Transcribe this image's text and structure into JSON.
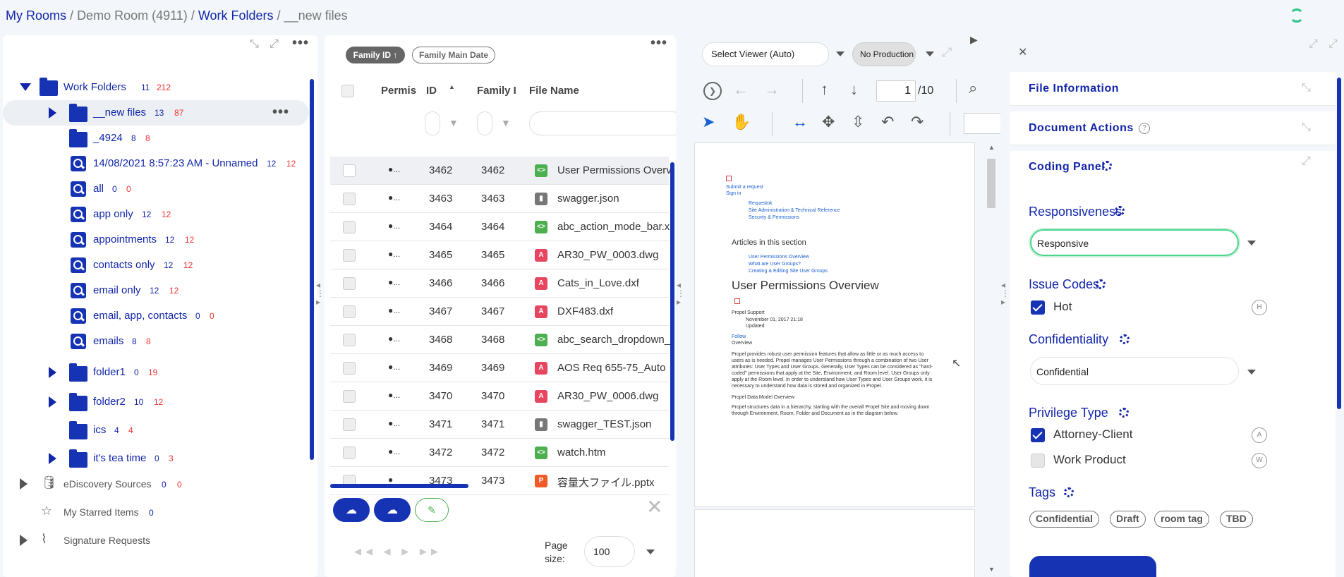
{
  "breadcrumb": {
    "root": "My Rooms",
    "sep": "/",
    "room": "Demo Room (4911)",
    "folders": "Work Folders",
    "current": "__new files"
  },
  "tree": {
    "root": {
      "label": "Work Folders",
      "c1": "11",
      "c2": "212"
    },
    "items": [
      {
        "label": "__new files",
        "c1": "13",
        "c2": "87",
        "icon": "folder-link-icon"
      },
      {
        "label": "_4924",
        "c1": "8",
        "c2": "8",
        "icon": "folder-link-icon"
      },
      {
        "label": "14/08/2021 8:57:23 AM - Unnamed",
        "c1": "12",
        "c2": "12",
        "icon": "saved-search-icon"
      },
      {
        "label": "all",
        "c1": "0",
        "c2": "0",
        "icon": "saved-search-icon"
      },
      {
        "label": "app only",
        "c1": "12",
        "c2": "12",
        "icon": "saved-search-icon"
      },
      {
        "label": "appointments",
        "c1": "12",
        "c2": "12",
        "icon": "saved-search-icon"
      },
      {
        "label": "contacts only",
        "c1": "12",
        "c2": "12",
        "icon": "saved-search-icon"
      },
      {
        "label": "email only",
        "c1": "12",
        "c2": "12",
        "icon": "saved-search-icon"
      },
      {
        "label": "email, app, contacts",
        "c1": "0",
        "c2": "0",
        "icon": "saved-search-icon"
      },
      {
        "label": "emails",
        "c1": "8",
        "c2": "8",
        "icon": "saved-search-icon"
      },
      {
        "label": "folder1",
        "c1": "0",
        "c2": "19",
        "icon": "folder-link-icon"
      },
      {
        "label": "folder2",
        "c1": "10",
        "c2": "12",
        "icon": "folder-link-icon"
      },
      {
        "label": "ics",
        "c1": "4",
        "c2": "4",
        "icon": "folder-link-icon"
      },
      {
        "label": "it's tea time",
        "c1": "0",
        "c2": "3",
        "icon": "folder-link-icon"
      }
    ],
    "bottom": [
      {
        "label": "eDiscovery Sources",
        "c1": "0",
        "c2": "0",
        "icon": "database-icon"
      },
      {
        "label": "My Starred Items",
        "c1": "0",
        "icon": "star-icon"
      },
      {
        "label": "Signature Requests",
        "icon": "signature-icon"
      }
    ]
  },
  "grid": {
    "sort_pills": [
      "Family ID ↑",
      "Family Main Date"
    ],
    "columns": {
      "perm": "Permis",
      "id": "ID",
      "family": "Family I",
      "filename": "File Name"
    },
    "rows": [
      {
        "perm": "●...",
        "id": "3462",
        "family": "3462",
        "type": "code",
        "name": "User Permissions Overv"
      },
      {
        "perm": "●...",
        "id": "3463",
        "family": "3463",
        "type": "doc",
        "name": "swagger.json"
      },
      {
        "perm": "●...",
        "id": "3464",
        "family": "3464",
        "type": "code",
        "name": "abc_action_mode_bar.x"
      },
      {
        "perm": "●...",
        "id": "3465",
        "family": "3465",
        "type": "cad",
        "name": "AR30_PW_0003.dwg"
      },
      {
        "perm": "●...",
        "id": "3466",
        "family": "3466",
        "type": "cad",
        "name": "Cats_in_Love.dxf"
      },
      {
        "perm": "●...",
        "id": "3467",
        "family": "3467",
        "type": "cad",
        "name": "DXF483.dxf"
      },
      {
        "perm": "●...",
        "id": "3468",
        "family": "3468",
        "type": "code",
        "name": "abc_search_dropdown_"
      },
      {
        "perm": "●...",
        "id": "3469",
        "family": "3469",
        "type": "cad",
        "name": "AOS Req 655-75_Auto"
      },
      {
        "perm": "●...",
        "id": "3470",
        "family": "3470",
        "type": "cad",
        "name": "AR30_PW_0006.dwg"
      },
      {
        "perm": "●...",
        "id": "3471",
        "family": "3471",
        "type": "doc",
        "name": "swagger_TEST.json"
      },
      {
        "perm": "●...",
        "id": "3472",
        "family": "3472",
        "type": "code",
        "name": "watch.htm"
      },
      {
        "perm": "●",
        "id": "3473",
        "family": "3473",
        "type": "ppt",
        "name": "容量大ファイル.pptx"
      }
    ],
    "page_size_label": "Page size:",
    "page_size": "100"
  },
  "viewer": {
    "select_viewer": "Select Viewer (Auto)",
    "production": "No Production",
    "page": "1",
    "page_total": "/10",
    "doc": {
      "links_top": [
        "Submit a request",
        "Sign in"
      ],
      "list": [
        "Requestok",
        "Site Administration & Technical Reference",
        "Security & Permissions"
      ],
      "section": "Articles in this section",
      "articles": [
        "User Permissions Overview",
        "What are User Groups?",
        "Creating & Editing Site User Groups"
      ],
      "title": "User Permissions Overview",
      "author": "Propel Support",
      "meta": [
        "November 01, 2017 21:18",
        "Updated"
      ],
      "follow": "Follow",
      "overview": "Overview",
      "body": "Propel provides robust user permission features that allow as little or as much access to users as is needed. Propel manages User Permissions through a combination of two User attributes: User Types and User Groups. Generally, User Types can be considered as \"hard-coded\" permissions that apply at the Site, Environment, and Room level. User Groups only apply at the Room level. In order to understand how User Types and User Groups work, it is necessary to understand how data is stored and organized in Propel.",
      "subhead": "Propel Data Model Overview",
      "body2": "Propel structures data in a hierarchy, starting with the overall Propel Site and moving down through Environment, Room, Folder and Document as in the diagram below."
    }
  },
  "right": {
    "sections": [
      "File Information",
      "Document Actions",
      "Coding Panel"
    ],
    "responsiveness": {
      "label": "Responsiveness",
      "value": "Responsive"
    },
    "issue_codes": {
      "label": "Issue Codes",
      "items": [
        {
          "label": "Hot",
          "checked": true,
          "hotkey": "H"
        }
      ]
    },
    "confidentiality": {
      "label": "Confidentiality",
      "value": "Confidential"
    },
    "privilege": {
      "label": "Privilege Type",
      "items": [
        {
          "label": "Attorney-Client",
          "checked": true,
          "hotkey": "A"
        },
        {
          "label": "Work Product",
          "checked": false,
          "hotkey": "W"
        }
      ]
    },
    "tags": {
      "label": "Tags",
      "items": [
        "Confidential",
        "Draft",
        "room tag",
        "TBD"
      ]
    }
  },
  "colors": {
    "brand": "#1226aa",
    "accent_red": "#e33333",
    "green": "#4caf50",
    "cad": "#e74660"
  }
}
